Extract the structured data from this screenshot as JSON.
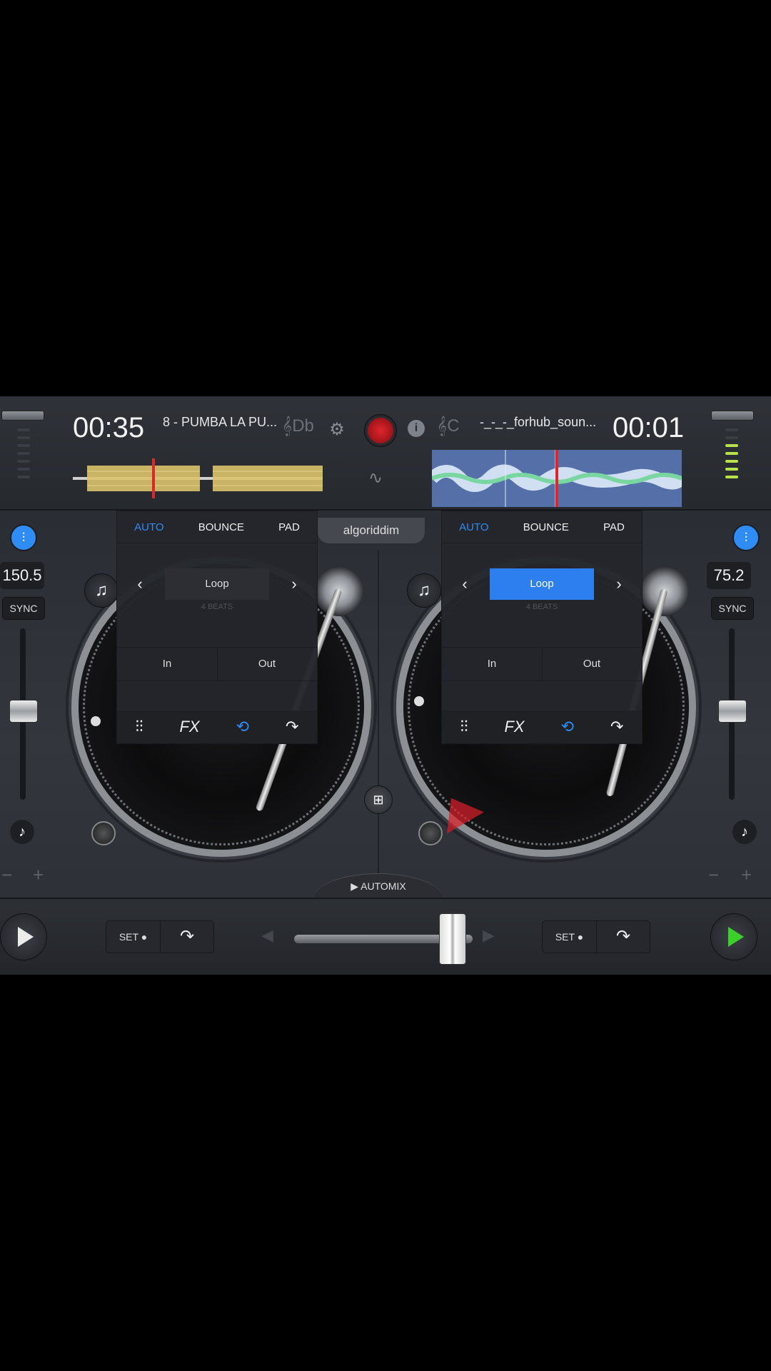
{
  "deck_left": {
    "time": "00:35",
    "track": "8 - PUMBA LA PU...",
    "key": "Db",
    "bpm": "150.5",
    "sync": "SYNC",
    "tabs": [
      "AUTO",
      "BOUNCE",
      "PAD"
    ],
    "active_tab": "AUTO",
    "loop_label": "Loop",
    "loop_active": false,
    "beats": "4 BEATS",
    "in_label": "In",
    "out_label": "Out",
    "cue_set": "SET ●",
    "waveform_color": "#d9c36a"
  },
  "deck_right": {
    "time": "00:01",
    "track": "-_-_-_forhub_soun...",
    "key": "C",
    "bpm": "75.2",
    "sync": "SYNC",
    "tabs": [
      "AUTO",
      "BOUNCE",
      "PAD"
    ],
    "active_tab": "AUTO",
    "loop_label": "Loop",
    "loop_active": true,
    "beats": "4 BEATS",
    "in_label": "In",
    "out_label": "Out",
    "cue_set": "SET ●",
    "waveform_color": "#9fc8ff"
  },
  "center": {
    "logo": "algoriddim",
    "automix": "▶ AUTOMIX"
  },
  "colors": {
    "accent": "#2f8cf5",
    "loop_active_bg": "#2d7ff0",
    "record": "#c8141a",
    "play_right": "#3bd12a",
    "meter_green": "#b6e24a"
  },
  "icons": {
    "settings": "gear-icon",
    "record": "record-button",
    "info": "info-icon",
    "waveform": "waveform-icon",
    "eq": "eq-icon",
    "fx": "fx-icon",
    "loop": "loop-icon",
    "jump": "jump-icon"
  }
}
